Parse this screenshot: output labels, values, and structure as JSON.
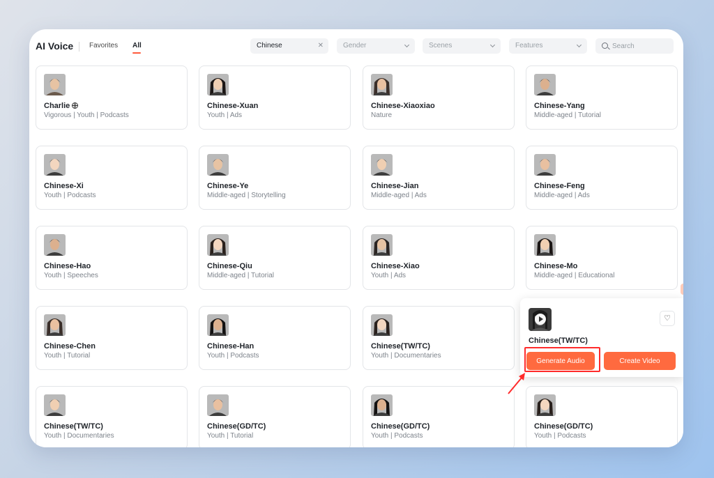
{
  "app": {
    "title": "AI Voice"
  },
  "tabs": [
    {
      "label": "Favorites",
      "active": false
    },
    {
      "label": "All",
      "active": true
    }
  ],
  "filters": {
    "language": {
      "value": "Chinese",
      "clear_icon": "close-icon"
    },
    "gender": {
      "placeholder": "Gender"
    },
    "scenes": {
      "placeholder": "Scenes"
    },
    "features": {
      "placeholder": "Features"
    },
    "search": {
      "placeholder": "Search",
      "value": ""
    }
  },
  "voices": [
    {
      "name": "Charlie",
      "tags": "Vigorous | Youth | Podcasts",
      "badge": "globe-icon"
    },
    {
      "name": "Chinese-Xuan",
      "tags": "Youth | Ads"
    },
    {
      "name": "Chinese-Xiaoxiao",
      "tags": "Nature"
    },
    {
      "name": "Chinese-Yang",
      "tags": "Middle-aged | Tutorial"
    },
    {
      "name": "Chinese-Xi",
      "tags": "Youth | Podcasts"
    },
    {
      "name": "Chinese-Ye",
      "tags": "Middle-aged | Storytelling"
    },
    {
      "name": "Chinese-Jian",
      "tags": "Middle-aged | Ads"
    },
    {
      "name": "Chinese-Feng",
      "tags": "Middle-aged | Ads"
    },
    {
      "name": "Chinese-Hao",
      "tags": "Youth | Speeches"
    },
    {
      "name": "Chinese-Qiu",
      "tags": "Middle-aged | Tutorial"
    },
    {
      "name": "Chinese-Xiao",
      "tags": "Youth | Ads"
    },
    {
      "name": "Chinese-Mo",
      "tags": "Middle-aged | Educational"
    },
    {
      "name": "Chinese-Chen",
      "tags": "Youth | Tutorial"
    },
    {
      "name": "Chinese-Han",
      "tags": "Youth | Podcasts"
    },
    {
      "name": "Chinese(TW/TC)",
      "tags": "Youth | Documentaries"
    },
    {
      "name": "Chinese(TW/TC)",
      "tags": ""
    },
    {
      "name": "Chinese(TW/TC)",
      "tags": "Youth | Documentaries"
    },
    {
      "name": "Chinese(GD/TC)",
      "tags": "Youth | Tutorial"
    },
    {
      "name": "Chinese(GD/TC)",
      "tags": "Youth | Podcasts"
    },
    {
      "name": "Chinese(GD/TC)",
      "tags": "Youth | Podcasts"
    }
  ],
  "popup": {
    "name": "Chinese(TW/TC)",
    "fav_icon": "heart-icon",
    "play_icon": "play-icon",
    "generate_label": "Generate Audio",
    "video_label": "Create Video"
  },
  "colors": {
    "accent": "#ff6a3f",
    "highlight": "#ff2b2b",
    "tab_underline": "#ff5a3c"
  }
}
